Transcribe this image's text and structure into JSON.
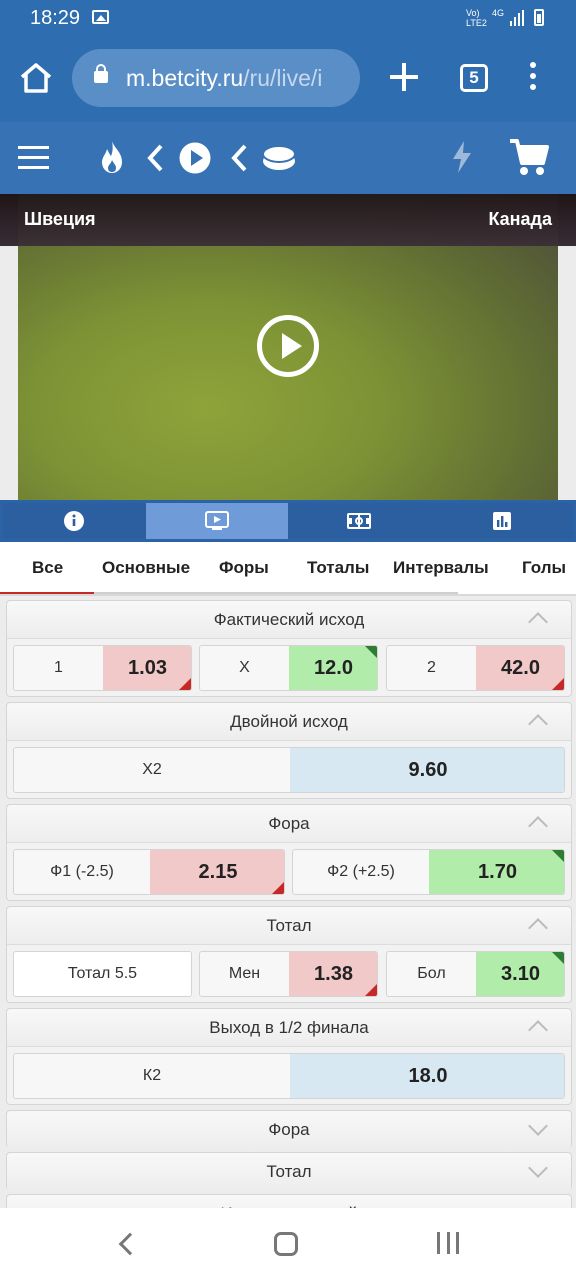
{
  "status_bar": {
    "time": "18:29",
    "network": "Vo)\nLTE2",
    "network_type": "4G"
  },
  "browser": {
    "url_domain": "m.betcity.ru",
    "url_path": "/ru/live/i",
    "tab_count": "5"
  },
  "video": {
    "home_team": "Швеция",
    "away_team": "Канада"
  },
  "market_tabs": [
    "Все",
    "Основные",
    "Форы",
    "Тоталы",
    "Интервалы",
    "Голы"
  ],
  "markets": {
    "result": {
      "title": "Фактический исход",
      "outcomes": [
        {
          "label": "1",
          "odd": "1.03",
          "trend": "down"
        },
        {
          "label": "X",
          "odd": "12.0",
          "trend": "up"
        },
        {
          "label": "2",
          "odd": "42.0",
          "trend": "down"
        }
      ]
    },
    "double": {
      "title": "Двойной исход",
      "label": "X2",
      "odd": "9.60"
    },
    "handicap": {
      "title": "Фора",
      "outcomes": [
        {
          "label": "Ф1 (-2.5)",
          "odd": "2.15",
          "trend": "down"
        },
        {
          "label": "Ф2 (+2.5)",
          "odd": "1.70",
          "trend": "up"
        }
      ]
    },
    "total": {
      "title": "Тотал",
      "line": "Тотал 5.5",
      "under_label": "Мен",
      "under_odd": "1.38",
      "over_label": "Бол",
      "over_odd": "3.10"
    },
    "semi": {
      "title": "Выход в 1/2 финала",
      "label": "К2",
      "odd": "18.0"
    },
    "collapsed": [
      "Фора",
      "Тотал"
    ],
    "partial_title": "Индивидуальный"
  },
  "colors": {
    "brand_blue": "#2d6db0",
    "odd_down": "#f2c9c9",
    "odd_up": "#b1ecaa",
    "odd_neutral": "#d8e8f3"
  }
}
